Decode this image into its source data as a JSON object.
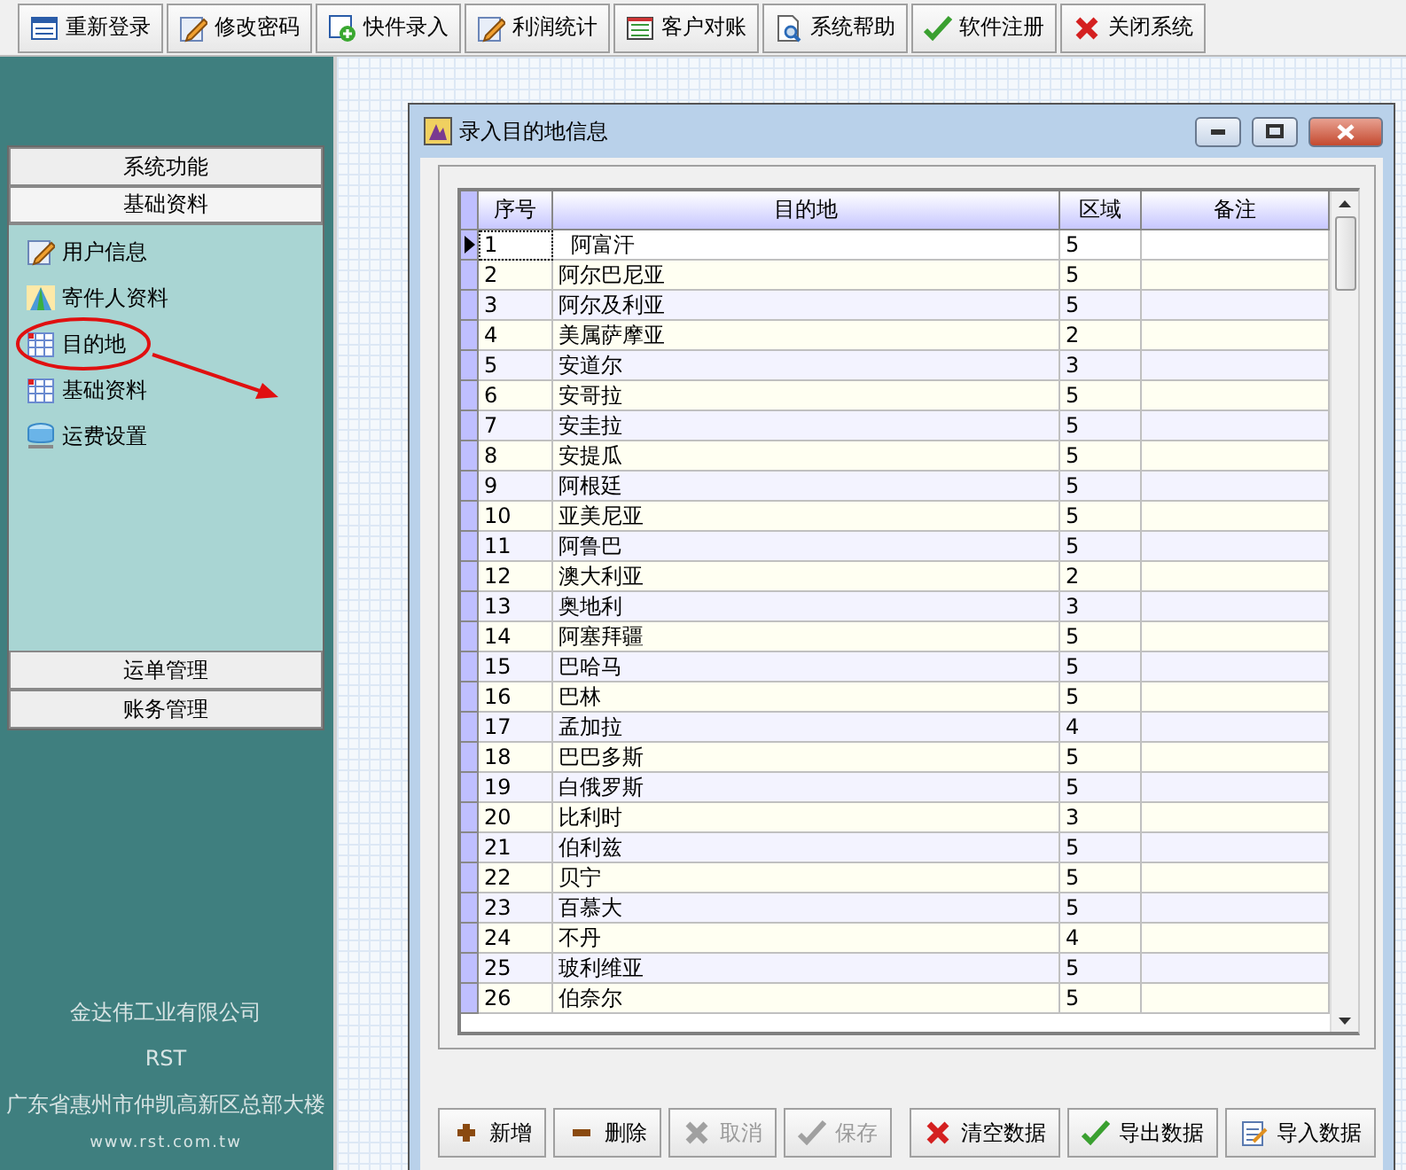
{
  "toolbar": [
    {
      "label": "重新登录",
      "kind": "window"
    },
    {
      "label": "修改密码",
      "kind": "pencil"
    },
    {
      "label": "快件录入",
      "kind": "add"
    },
    {
      "label": "利润统计",
      "kind": "pencil"
    },
    {
      "label": "客户对账",
      "kind": "list"
    },
    {
      "label": "系统帮助",
      "kind": "search"
    },
    {
      "label": "软件注册",
      "kind": "check"
    },
    {
      "label": "关闭系统",
      "kind": "cross"
    }
  ],
  "sidebar": {
    "top_groups": [
      {
        "label": "系统功能",
        "expanded": false
      },
      {
        "label": "基础资料",
        "expanded": true
      }
    ],
    "items": [
      {
        "label": "用户信息",
        "kind": "pencil"
      },
      {
        "label": "寄件人资料",
        "kind": "tent"
      },
      {
        "label": "目的地",
        "kind": "grid"
      },
      {
        "label": "基础资料",
        "kind": "grid"
      },
      {
        "label": "运费设置",
        "kind": "bowl"
      }
    ],
    "bottom_groups": [
      {
        "label": "运单管理",
        "expanded": false
      },
      {
        "label": "账务管理",
        "expanded": false
      }
    ],
    "footer": [
      "金达伟工业有限公司",
      "RST",
      "广东省惠州市仲凯高新区总部大楼",
      "www.rst.com.tw"
    ]
  },
  "window": {
    "title": "录入目的地信息"
  },
  "table": {
    "columns": [
      "序号",
      "目的地",
      "区域",
      "备注"
    ],
    "rows": [
      {
        "cells": [
          "1",
          "阿富汗",
          "5",
          ""
        ],
        "selected": true
      },
      {
        "cells": [
          "2",
          "阿尔巴尼亚",
          "5",
          ""
        ],
        "selected": false
      },
      {
        "cells": [
          "3",
          "阿尔及利亚",
          "5",
          ""
        ],
        "selected": false
      },
      {
        "cells": [
          "4",
          "美属萨摩亚",
          "2",
          ""
        ],
        "selected": false
      },
      {
        "cells": [
          "5",
          "安道尔",
          "3",
          ""
        ],
        "selected": false
      },
      {
        "cells": [
          "6",
          "安哥拉",
          "5",
          ""
        ],
        "selected": false
      },
      {
        "cells": [
          "7",
          "安圭拉",
          "5",
          ""
        ],
        "selected": false
      },
      {
        "cells": [
          "8",
          "安提瓜",
          "5",
          ""
        ],
        "selected": false
      },
      {
        "cells": [
          "9",
          "阿根廷",
          "5",
          ""
        ],
        "selected": false
      },
      {
        "cells": [
          "10",
          "亚美尼亚",
          "5",
          ""
        ],
        "selected": false
      },
      {
        "cells": [
          "11",
          "阿鲁巴",
          "5",
          ""
        ],
        "selected": false
      },
      {
        "cells": [
          "12",
          "澳大利亚",
          "2",
          ""
        ],
        "selected": false
      },
      {
        "cells": [
          "13",
          "奥地利",
          "3",
          ""
        ],
        "selected": false
      },
      {
        "cells": [
          "14",
          "阿塞拜疆",
          "5",
          ""
        ],
        "selected": false
      },
      {
        "cells": [
          "15",
          "巴哈马",
          "5",
          ""
        ],
        "selected": false
      },
      {
        "cells": [
          "16",
          "巴林",
          "5",
          ""
        ],
        "selected": false
      },
      {
        "cells": [
          "17",
          "孟加拉",
          "4",
          ""
        ],
        "selected": false
      },
      {
        "cells": [
          "18",
          "巴巴多斯",
          "5",
          ""
        ],
        "selected": false
      },
      {
        "cells": [
          "19",
          "白俄罗斯",
          "5",
          ""
        ],
        "selected": false
      },
      {
        "cells": [
          "20",
          "比利时",
          "3",
          ""
        ],
        "selected": false
      },
      {
        "cells": [
          "21",
          "伯利兹",
          "5",
          ""
        ],
        "selected": false
      },
      {
        "cells": [
          "22",
          "贝宁",
          "5",
          ""
        ],
        "selected": false
      },
      {
        "cells": [
          "23",
          "百慕大",
          "5",
          ""
        ],
        "selected": false
      },
      {
        "cells": [
          "24",
          "不丹",
          "4",
          ""
        ],
        "selected": false
      },
      {
        "cells": [
          "25",
          "玻利维亚",
          "5",
          ""
        ],
        "selected": false
      },
      {
        "cells": [
          "26",
          "伯奈尔",
          "5",
          ""
        ],
        "selected": false
      }
    ]
  },
  "left_buttons": [
    {
      "label": "新增",
      "kind": "plus",
      "disabled": false
    },
    {
      "label": "删除",
      "kind": "minus",
      "disabled": false
    },
    {
      "label": "取消",
      "kind": "cross",
      "disabled": true
    },
    {
      "label": "保存",
      "kind": "check",
      "disabled": true
    }
  ],
  "right_buttons": [
    {
      "label": "清空数据",
      "kind": "cross"
    },
    {
      "label": "导出数据",
      "kind": "check"
    },
    {
      "label": "导入数据",
      "kind": "note"
    }
  ]
}
